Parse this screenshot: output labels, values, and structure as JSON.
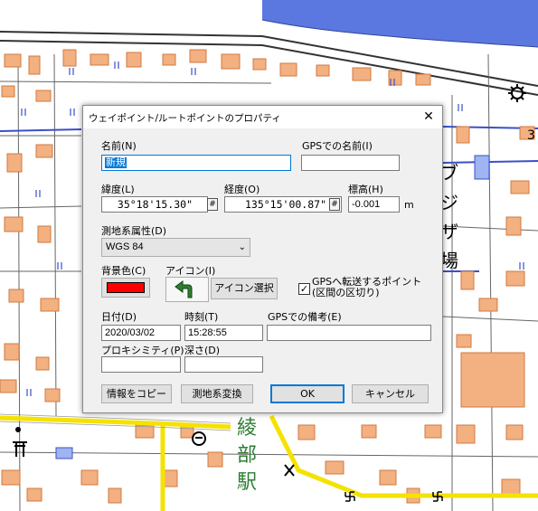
{
  "dialog": {
    "title": "ウェイポイント/ルートポイントのプロパティ",
    "close_glyph": "✕",
    "name_label": "名前(N)",
    "name_value": "新規",
    "gps_name_label": "GPSでの名前(I)",
    "gps_name_value": "",
    "lat_label": "緯度(L)",
    "lat_value": "35°18'15.30\"",
    "lon_label": "経度(O)",
    "lon_value": "135°15'00.87\"",
    "alt_label": "標高(H)",
    "alt_value": "-0.001",
    "alt_unit": "m",
    "stepper_glyph": "#",
    "datum_label": "測地系属性(D)",
    "datum_value": "WGS 84",
    "bg_color_label": "背景色(C)",
    "bg_color": "#ff0000",
    "icon_label": "アイコン(I)",
    "icon_select_button": "アイコン選択",
    "gps_transfer_check_line1": "GPSへ転送するポイント",
    "gps_transfer_check_line2": "(区間の区切り)",
    "gps_transfer_checked": true,
    "date_label": "日付(D)",
    "date_value": "2020/03/02",
    "time_label": "時刻(T)",
    "time_value": "15:28:55",
    "gps_note_label": "GPSでの備考(E)",
    "gps_note_value": "",
    "proximity_label": "プロキシミティ(P)",
    "proximity_value": "",
    "depth_label": "深さ(D)",
    "depth_value": "",
    "copy_button": "情報をコピー",
    "datum_convert_button": "測地系変換",
    "ok_button": "OK",
    "cancel_button": "キャンセル"
  },
  "map": {
    "station_chars": [
      "綾",
      "部",
      "駅"
    ],
    "side_chars": [
      "ブ",
      "ジ",
      "ザ",
      "場"
    ],
    "right_label": "3",
    "colors": {
      "water": "#5b78e0",
      "building": "#f3b080",
      "building_edge": "#d07a40",
      "road_yellow": "#f5e200",
      "station_text": "#2e7d32"
    },
    "icons": [
      "factory-icon",
      "post-office-icon",
      "shrine-icon",
      "police-box-icon",
      "temple-icon",
      "school-icon"
    ]
  }
}
